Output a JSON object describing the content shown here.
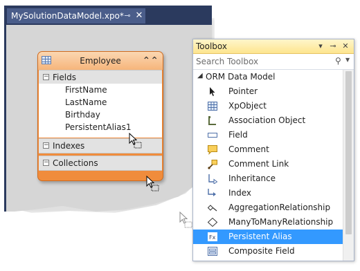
{
  "document": {
    "tab_title": "MySolutionDataModel.xpo*",
    "pin_glyph": "⊸",
    "close_glyph": "✕"
  },
  "entity": {
    "title": "Employee",
    "icon": "class-grid-icon",
    "collapse_glyph": "⌃⌃",
    "sections": {
      "fields": {
        "label": "Fields",
        "toggle": "−"
      },
      "indexes": {
        "label": "Indexes",
        "toggle": "−"
      },
      "collections": {
        "label": "Collections",
        "toggle": "−"
      }
    },
    "fields": [
      "FirstName",
      "LastName",
      "Birthday",
      "PersistentAlias1"
    ]
  },
  "toolbox": {
    "title": "Toolbox",
    "title_buttons": [
      "▾",
      "⊸",
      "✕"
    ],
    "search_placeholder": "Search Toolbox",
    "group": {
      "label": "ORM Data Model",
      "arrow": "◢"
    },
    "items": [
      {
        "label": "Pointer",
        "icon": "pointer-icon"
      },
      {
        "label": "XpObject",
        "icon": "xpobject-icon"
      },
      {
        "label": "Association Object",
        "icon": "association-object-icon"
      },
      {
        "label": "Field",
        "icon": "field-icon"
      },
      {
        "label": "Comment",
        "icon": "comment-icon"
      },
      {
        "label": "Comment Link",
        "icon": "comment-link-icon"
      },
      {
        "label": "Inheritance",
        "icon": "inheritance-icon"
      },
      {
        "label": "Index",
        "icon": "index-icon"
      },
      {
        "label": "AggregationRelationship",
        "icon": "aggregation-icon"
      },
      {
        "label": "ManyToManyRelationship",
        "icon": "many-to-many-icon"
      },
      {
        "label": "Persistent Alias",
        "icon": "persistent-alias-icon",
        "selected": true
      },
      {
        "label": "Composite Field",
        "icon": "composite-field-icon"
      }
    ]
  },
  "colors": {
    "entity_orange": "#f08c3c",
    "tab_navy": "#2b3a5e",
    "toolbox_title": "#fde58e",
    "selection_blue": "#3399ff"
  }
}
